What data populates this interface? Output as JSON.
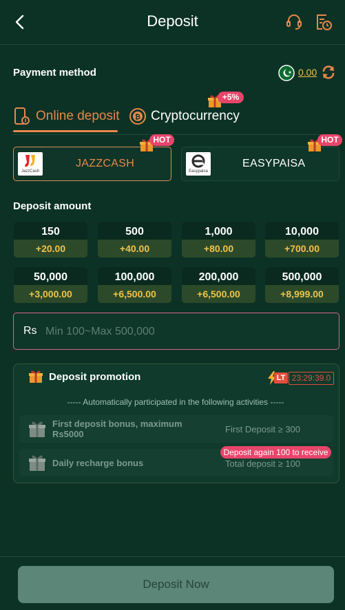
{
  "header": {
    "title": "Deposit"
  },
  "payment": {
    "label": "Payment method",
    "balance": "0.00"
  },
  "tabs": [
    {
      "label": "Online deposit",
      "active": true
    },
    {
      "label": "Cryptocurrency",
      "badge": "+5%"
    }
  ],
  "methods": [
    {
      "name": "JAZZCASH",
      "logo_text": "JazzCash",
      "badge": "HOT",
      "active": true
    },
    {
      "name": "EASYPAISA",
      "logo_text": "Easypaisa",
      "badge": "HOT"
    }
  ],
  "amount": {
    "label": "Deposit amount",
    "options": [
      {
        "value": "150",
        "bonus": "+20.00"
      },
      {
        "value": "500",
        "bonus": "+40.00"
      },
      {
        "value": "1,000",
        "bonus": "+80.00"
      },
      {
        "value": "10,000",
        "bonus": "+700.00"
      },
      {
        "value": "50,000",
        "bonus": "+3,000.00"
      },
      {
        "value": "100,000",
        "bonus": "+6,500.00"
      },
      {
        "value": "200,000",
        "bonus": "+6,500.00"
      },
      {
        "value": "500,000",
        "bonus": "+8,999.00"
      }
    ],
    "currency": "Rs",
    "placeholder": "Min 100~Max 500,000"
  },
  "promo": {
    "title": "Deposit promotion",
    "lt": "LT",
    "timer": "23:29:39.0",
    "note": "----- Automatically participated in the following activities -----",
    "items": [
      {
        "name": "First deposit bonus, maximum Rs5000",
        "condition": "First Deposit ≥ 300"
      },
      {
        "name": "Daily recharge bonus",
        "condition": "Total deposit ≥ 100",
        "tag": "Deposit again 100 to receive"
      }
    ]
  },
  "footer": {
    "button": "Deposit Now"
  },
  "colors": {
    "accent": "#e8884a",
    "background": "#0c3226",
    "bonus": "#f0c34a",
    "hot": "#e8456b"
  }
}
